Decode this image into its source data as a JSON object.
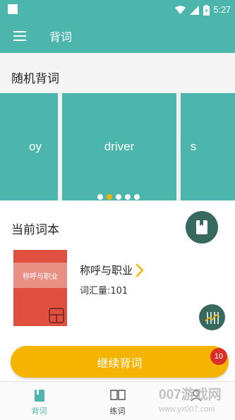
{
  "status_bar": {
    "time": "5:27"
  },
  "app_bar": {
    "title": "背词"
  },
  "random": {
    "title": "随机背词",
    "cards": [
      "oy",
      "driver",
      "s"
    ],
    "active_dot": 1,
    "dot_count": 5
  },
  "current_book": {
    "section_title": "当前词本",
    "cover_text": "称呼与职业",
    "name": "称呼与职业",
    "word_count": "词汇量:101"
  },
  "continue": {
    "label": "继续背词",
    "badge": "10"
  },
  "bottom_nav": {
    "items": [
      {
        "label": "背词",
        "icon": "book-icon",
        "active": true
      },
      {
        "label": "练词",
        "icon": "open-book-icon",
        "active": false
      },
      {
        "label": "",
        "icon": "profile-icon",
        "active": false
      }
    ]
  },
  "watermark": {
    "main": "007游戏网",
    "sub": "www.yx007.com"
  },
  "colors": {
    "teal": "#4db6ac",
    "dark_teal": "#37695f",
    "amber": "#f5b400",
    "badge_red": "#d9302a",
    "cover_red": "#e04f40"
  }
}
